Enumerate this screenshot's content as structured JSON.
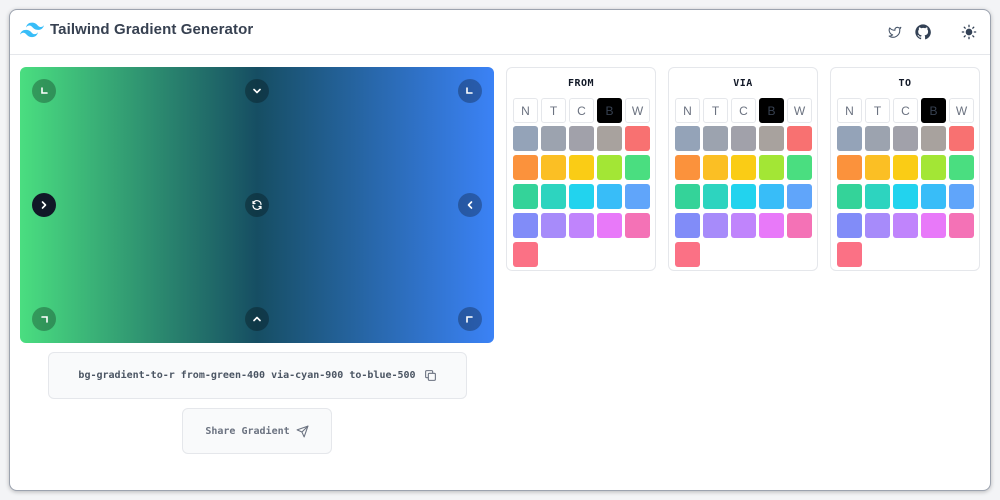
{
  "app": {
    "title": "Tailwind Gradient Generator"
  },
  "colors": {
    "gradient_from": "#4ade80",
    "gradient_via": "#164e63",
    "gradient_to": "#3b82f6",
    "tailwind_logo": "#38bdf8"
  },
  "header": {
    "icons": [
      "twitter-icon",
      "github-icon",
      "sun-icon"
    ]
  },
  "directions": [
    "to-tl",
    "to-t",
    "to-tr",
    "to-l",
    "reset",
    "to-r",
    "to-bl",
    "to-b",
    "to-br"
  ],
  "active_direction": "to-r",
  "class_output": {
    "text": "bg-gradient-to-r from-green-400 via-cyan-900 to-blue-500"
  },
  "share": {
    "label": "Share Gradient"
  },
  "tabs": [
    "N",
    "T",
    "C",
    "B",
    "W"
  ],
  "palette": [
    "#94a3b8",
    "#9ca3af",
    "#a1a1aa",
    "#a8a29e",
    "#f87171",
    "#fb923c",
    "#fbbf24",
    "#facc15",
    "#a3e635",
    "#4ade80",
    "#34d399",
    "#2dd4bf",
    "#22d3ee",
    "#38bdf8",
    "#60a5fa",
    "#818cf8",
    "#a78bfa",
    "#c084fc",
    "#e879f9",
    "#f472b6",
    "#fb7185"
  ],
  "panels": [
    {
      "title": "FROM",
      "active_tab": "B"
    },
    {
      "title": "VIA",
      "active_tab": "B"
    },
    {
      "title": "TO",
      "active_tab": "B"
    }
  ]
}
